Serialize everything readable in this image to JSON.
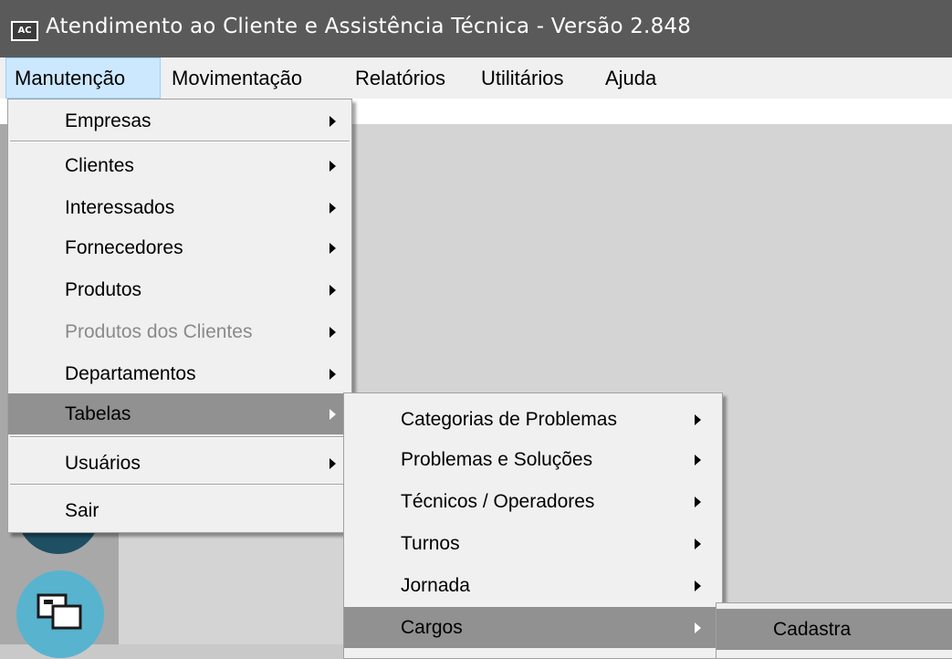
{
  "window": {
    "icon_text": "AC",
    "title": "Atendimento ao Cliente e Assistência Técnica - Versão 2.848"
  },
  "menubar": {
    "items": [
      {
        "label": "Manutenção"
      },
      {
        "label": "Movimentação"
      },
      {
        "label": "Relatórios"
      },
      {
        "label": "Utilitários"
      },
      {
        "label": "Ajuda"
      }
    ]
  },
  "manutencao_menu": {
    "items": [
      {
        "label": "Empresas"
      },
      {
        "label": "Clientes"
      },
      {
        "label": "Interessados"
      },
      {
        "label": "Fornecedores"
      },
      {
        "label": "Produtos"
      },
      {
        "label": "Produtos dos Clientes"
      },
      {
        "label": "Departamentos"
      },
      {
        "label": "Tabelas"
      },
      {
        "label": "Usuários"
      },
      {
        "label": "Sair"
      }
    ]
  },
  "tabelas_menu": {
    "items": [
      {
        "label": "Categorias de Problemas"
      },
      {
        "label": "Problemas e Soluções"
      },
      {
        "label": "Técnicos / Operadores"
      },
      {
        "label": "Turnos"
      },
      {
        "label": "Jornada"
      },
      {
        "label": "Cargos"
      }
    ]
  },
  "cargos_menu": {
    "items": [
      {
        "label": "Cadastra"
      }
    ]
  },
  "colors": {
    "titlebar": "#5a5a5a",
    "menu_bg": "#f0f0f0",
    "highlight": "#919191",
    "active_menubar": "#cce8ff"
  }
}
